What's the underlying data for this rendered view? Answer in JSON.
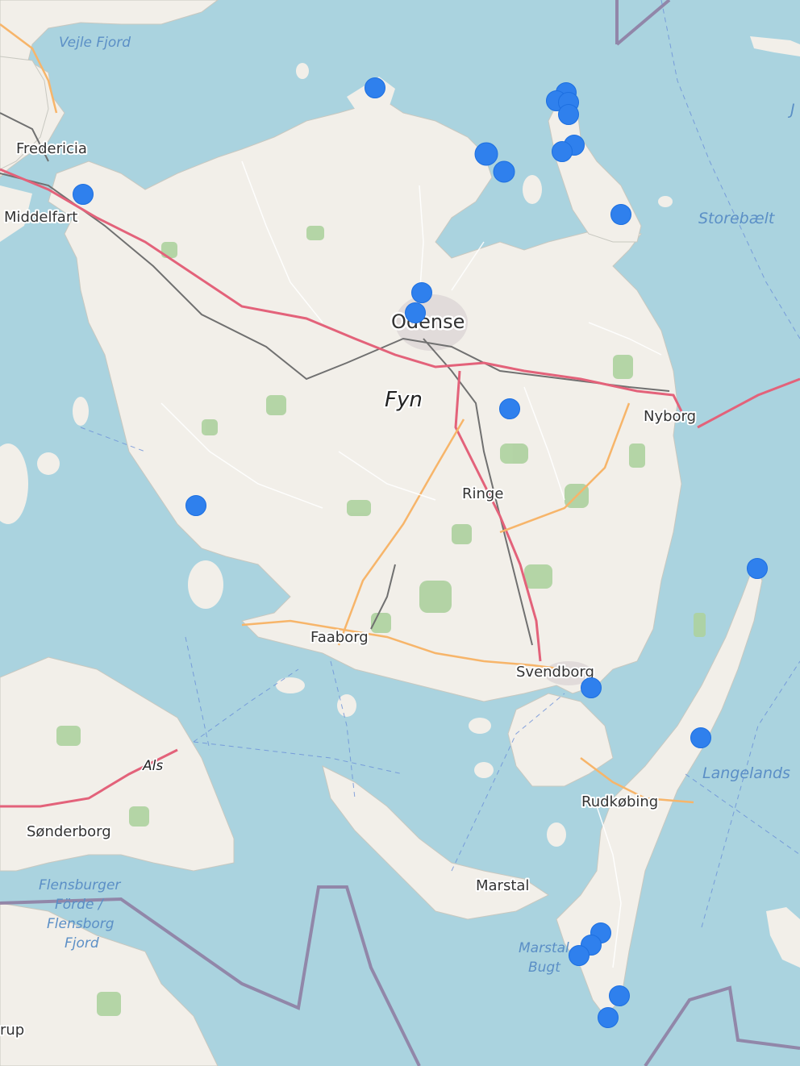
{
  "map": {
    "colors": {
      "water": "#aad3df",
      "land": "#f2efe9",
      "forest": "#add19e",
      "motorway": "#e3627a",
      "primary_road": "#f7b56a",
      "railway": "#707070",
      "border": "#8d79a0",
      "marker": "#2f80ed"
    },
    "labels": {
      "vejle_fjord": "Vejle Fjord",
      "fredericia": "Fredericia",
      "middelfart": "Middelfart",
      "storebaelt": "Storebælt",
      "odense": "Odense",
      "fyn": "Fyn",
      "nyborg": "Nyborg",
      "ringe": "Ringe",
      "faaborg": "Faaborg",
      "svendborg": "Svendborg",
      "als": "Als",
      "langelandsbaelt": "Langelands",
      "rudkobing": "Rudkøbing",
      "sonderborg": "Sønderborg",
      "flensburger_1": "Flensburger",
      "flensburger_2": "Förde /",
      "flensburger_3": "Flensborg",
      "flensburger_4": "Fjord",
      "marstal": "Marstal",
      "marstal_bugt_1": "Marstal",
      "marstal_bugt_2": "Bugt",
      "rup": "rup",
      "j": "J"
    },
    "marker_count": 22
  }
}
